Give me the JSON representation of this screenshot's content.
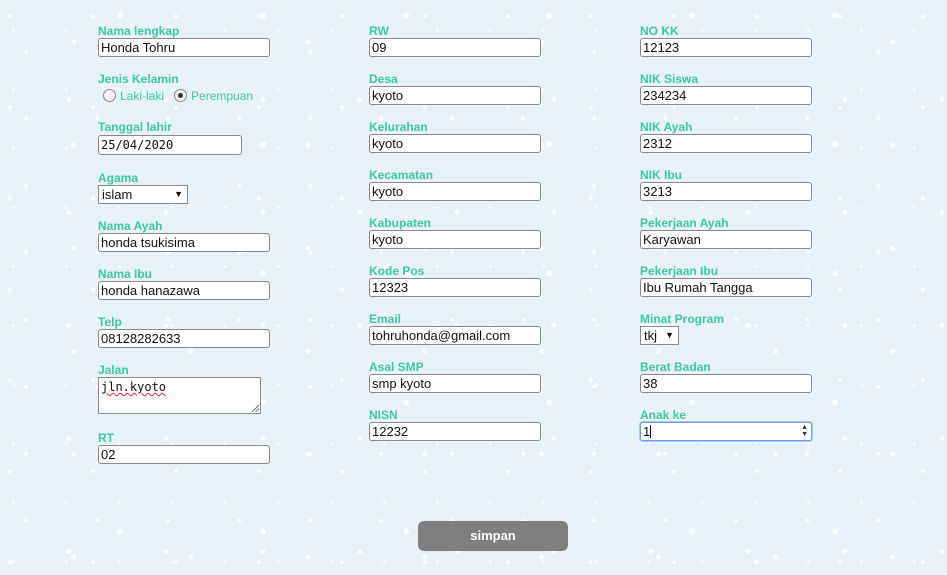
{
  "col1": {
    "nama_lengkap": {
      "label": "Nama lengkap",
      "value": "Honda Tohru"
    },
    "jenis_kelamin": {
      "label": "Jenis Kelamin",
      "options": [
        "Laki-laki",
        "Perempuan"
      ],
      "selected": "Perempuan"
    },
    "tanggal_lahir": {
      "label": "Tanggal lahir",
      "value": "25/04/2020"
    },
    "agama": {
      "label": "Agama",
      "value": "islam"
    },
    "nama_ayah": {
      "label": "Nama Ayah",
      "value": "honda tsukisima"
    },
    "nama_ibu": {
      "label": "Nama Ibu",
      "value": "honda hanazawa"
    },
    "telp": {
      "label": "Telp",
      "value": "08128282633"
    },
    "jalan": {
      "label": "Jalan",
      "value": "jln.kyoto"
    },
    "rt": {
      "label": "RT",
      "value": "02"
    }
  },
  "col2": {
    "rw": {
      "label": "RW",
      "value": "09"
    },
    "desa": {
      "label": "Desa",
      "value": "kyoto"
    },
    "kelurahan": {
      "label": "Kelurahan",
      "value": "kyoto"
    },
    "kecamatan": {
      "label": "Kecamatan",
      "value": "kyoto"
    },
    "kabupaten": {
      "label": "Kabupaten",
      "value": "kyoto"
    },
    "kode_pos": {
      "label": "Kode Pos",
      "value": "12323"
    },
    "email": {
      "label": "Email",
      "value": "tohruhonda@gmail.com"
    },
    "asal_smp": {
      "label": "Asal SMP",
      "value": "smp kyoto"
    },
    "nisn": {
      "label": "NISN",
      "value": "12232"
    }
  },
  "col3": {
    "no_kk": {
      "label": "NO KK",
      "value": "12123"
    },
    "nik_siswa": {
      "label": "NIK Siswa",
      "value": "234234"
    },
    "nik_ayah": {
      "label": "NIK Ayah",
      "value": "2312"
    },
    "nik_ibu": {
      "label": "NIK Ibu",
      "value": "3213"
    },
    "pekerjaan_ayah": {
      "label": "Pekerjaan Ayah",
      "value": "Karyawan"
    },
    "pekerjaan_ibu": {
      "label": "Pekerjaan Ibu",
      "value": "Ibu Rumah Tangga"
    },
    "minat_program": {
      "label": "Minat Program",
      "value": "tkj"
    },
    "berat_badan": {
      "label": "Berat Badan",
      "value": "38"
    },
    "anak_ke": {
      "label": "Anak ke",
      "value": "1"
    }
  },
  "submit_label": "simpan",
  "colors": {
    "label": "#3ec7a0",
    "button": "#7f7f7f",
    "background": "#e7f1f8"
  }
}
